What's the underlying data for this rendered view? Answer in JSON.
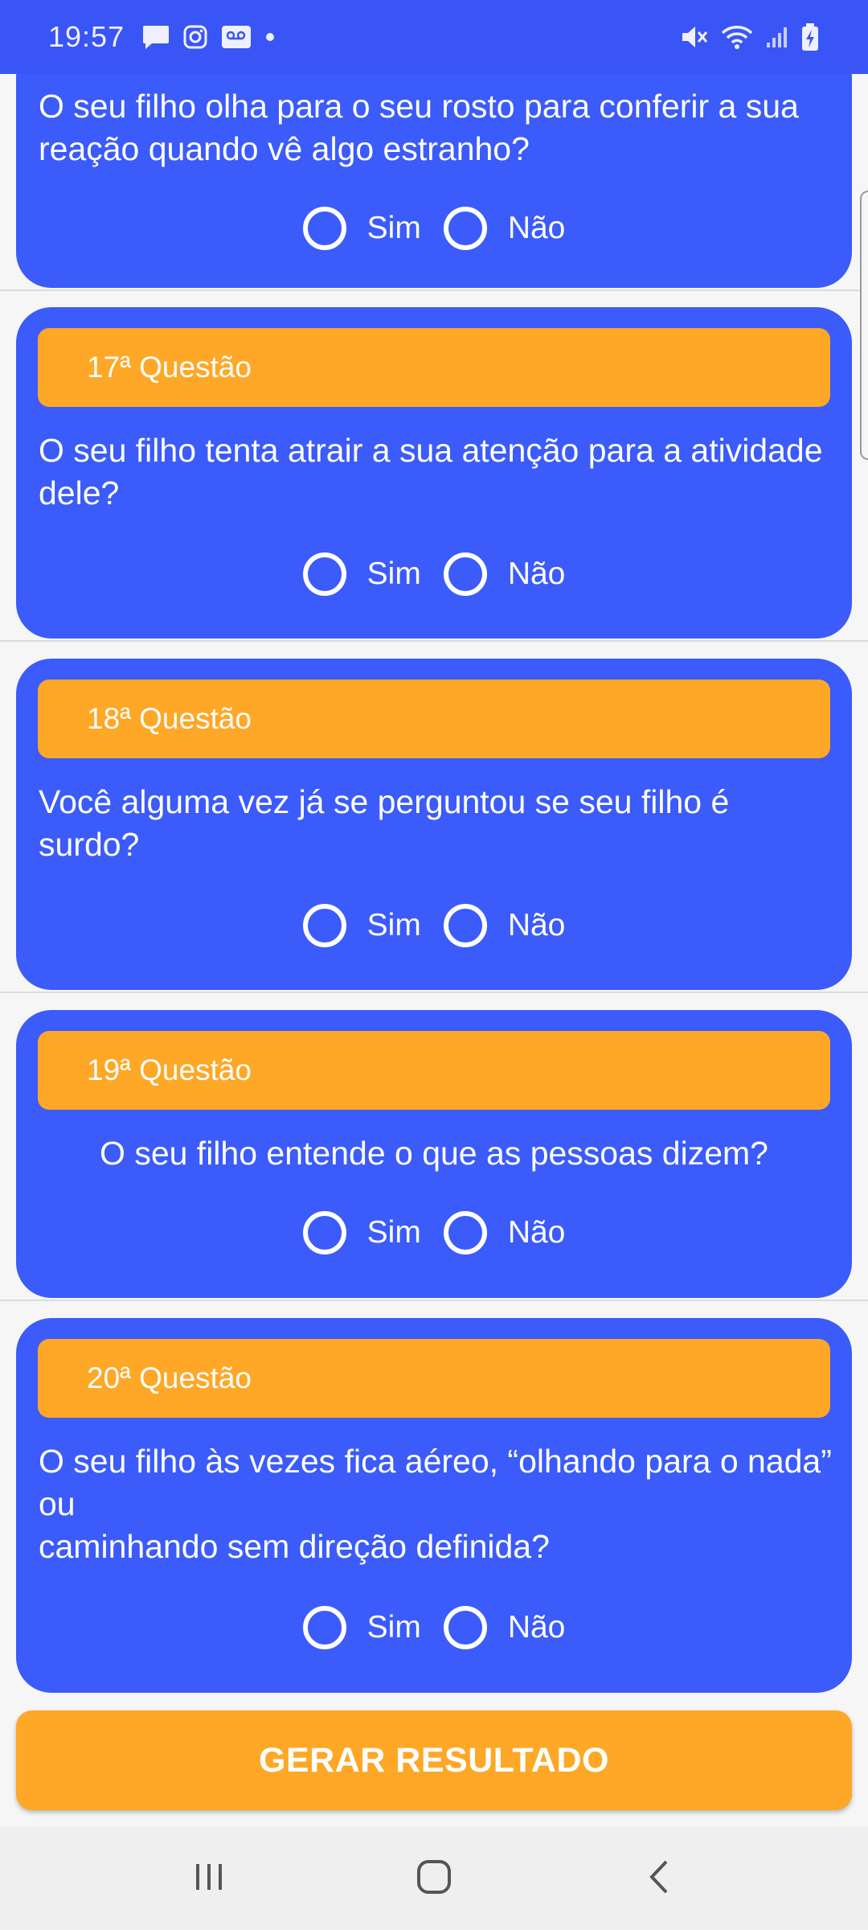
{
  "status_bar": {
    "time": "19:57",
    "left_icons": [
      "message-icon",
      "instagram-icon",
      "voicemail-icon",
      "dot-icon"
    ],
    "right_icons": [
      "mute-icon",
      "wifi-icon",
      "signal-icon",
      "battery-charging-icon"
    ]
  },
  "questions": [
    {
      "header": "",
      "text": "O seu filho olha para o seu rosto para conferir a sua reação quando vê algo estranho?",
      "yes": "Sim",
      "no": "Não"
    },
    {
      "header": "17ª Questão",
      "text": "O seu filho tenta atrair a sua atenção para a atividade dele?",
      "yes": "Sim",
      "no": "Não"
    },
    {
      "header": "18ª Questão",
      "text": "Você alguma vez já se perguntou se seu filho é surdo?",
      "yes": "Sim",
      "no": "Não"
    },
    {
      "header": "19ª Questão",
      "text": "O seu filho entende o que as pessoas dizem?",
      "yes": "Sim",
      "no": "Não"
    },
    {
      "header": "20ª Questão",
      "text": "O seu filho às vezes fica aéreo, “olhando para o nada” ou\ncaminhando sem direção definida?",
      "yes": "Sim",
      "no": "Não"
    }
  ],
  "action_button": "GERAR RESULTADO",
  "nav_bar": [
    "recents-icon",
    "home-icon",
    "back-icon"
  ],
  "colors": {
    "card": "#3b5bfb",
    "header": "#ffa726",
    "status_bar": "#3a55f5"
  }
}
